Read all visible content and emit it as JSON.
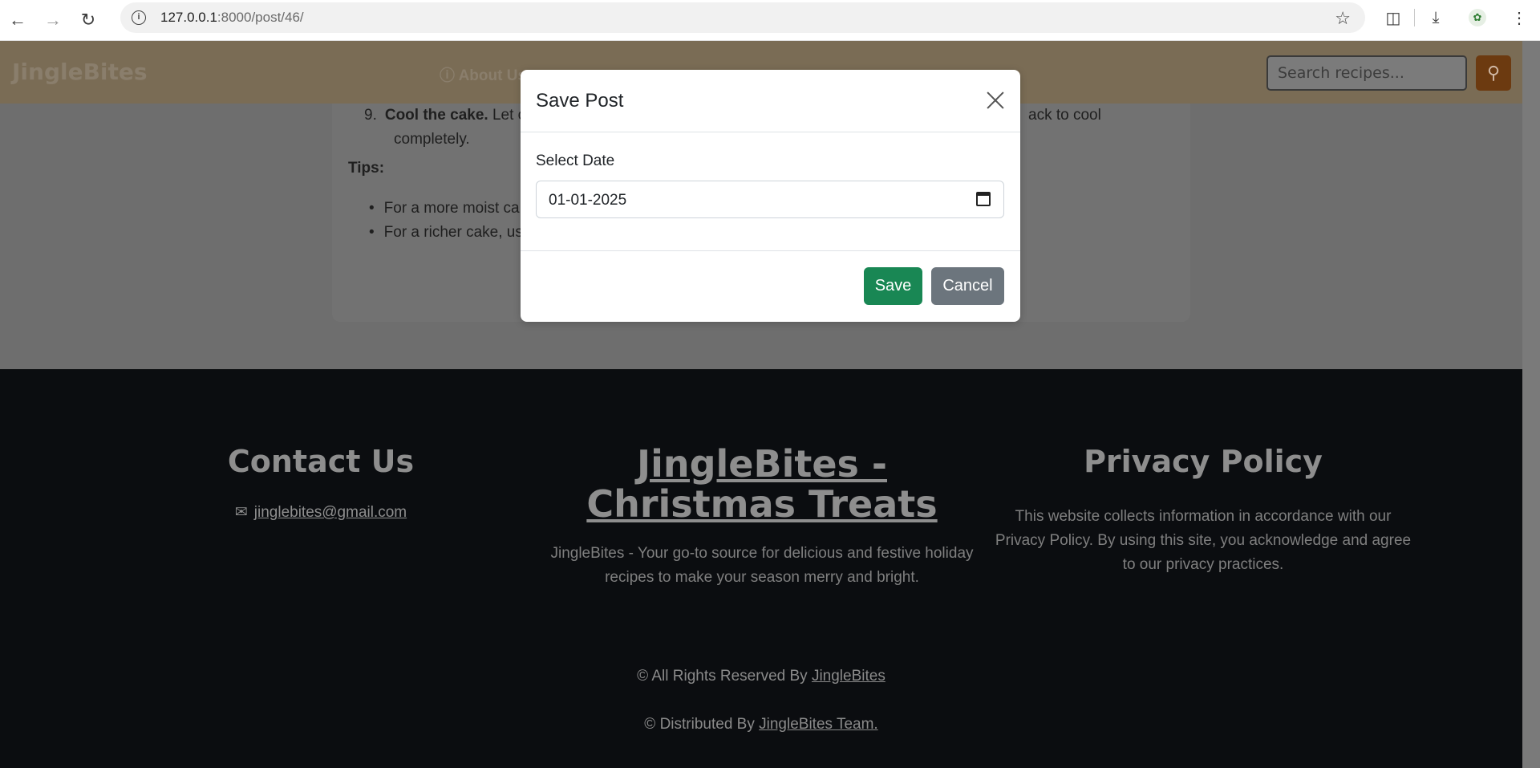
{
  "browser": {
    "url_host": "127.0.0.1",
    "url_rest": ":8000/post/46/"
  },
  "navbar": {
    "brand": "JingleBites",
    "menu_text": "About Us",
    "search_placeholder": "Search recipes..."
  },
  "content": {
    "step_number": "9.",
    "step_bold": "Cool the cake.",
    "step_text": " Let c",
    "step_text_end": "ack to cool",
    "step_line2": "completely.",
    "tips_heading": "Tips:",
    "tips": [
      "For a more moist ca",
      "For a richer cake, us"
    ]
  },
  "modal": {
    "title": "Save Post",
    "field_label": "Select Date",
    "date_value": "01-01-2025",
    "save_label": "Save",
    "cancel_label": "Cancel"
  },
  "footer": {
    "contact_heading": "Contact Us",
    "email": "jinglebites@gmail.com",
    "brand_heading": "JingleBites - Christmas Treats",
    "brand_text": "JingleBites - Your go-to source for delicious and festive holiday recipes to make your season merry and bright.",
    "privacy_heading": "Privacy Policy",
    "privacy_text": "This website collects information in accordance with our Privacy Policy. By using this site, you acknowledge and agree to our privacy practices.",
    "rights_prefix": "© All Rights Reserved By ",
    "rights_link": "JingleBites",
    "distributed_prefix": "© Distributed By ",
    "distributed_link": "JingleBites Team."
  }
}
